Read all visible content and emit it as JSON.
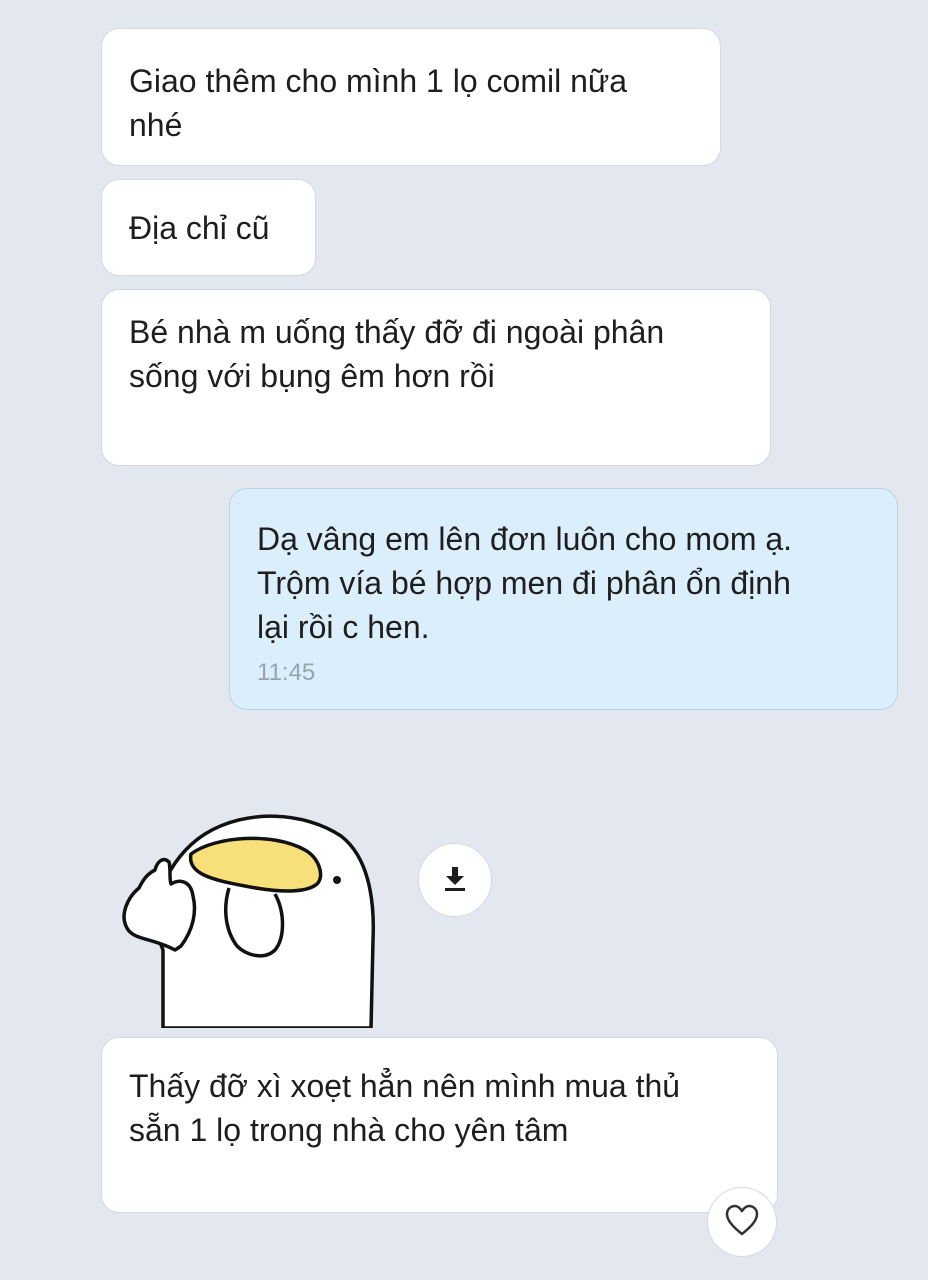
{
  "chat": {
    "messages": [
      {
        "direction": "incoming",
        "text": "Giao thêm cho mình 1 lọ comil nữa\nnhé"
      },
      {
        "direction": "incoming",
        "text": "Địa chỉ cũ"
      },
      {
        "direction": "incoming",
        "text": "Bé nhà m uống thấy đỡ đi ngoài phân\nsống với bụng êm hơn rồi"
      },
      {
        "direction": "outgoing",
        "text": "Dạ vâng em lên đơn luôn cho mom ạ.\nTrộm vía bé hợp men đi phân ổn định\nlại rồi c hen.",
        "time": "11:45"
      },
      {
        "direction": "incoming",
        "text": "Thấy đỡ xì xoẹt hẳn nên mình mua thủ\nsẵn 1 lọ trong nhà cho yên tâm"
      }
    ]
  },
  "icons": {
    "download": "download-icon",
    "like": "heart-icon"
  },
  "colors": {
    "background": "#e3e7ef",
    "incoming_bubble": "#ffffff",
    "outgoing_bubble": "#dbeefb",
    "timestamp": "#98a4ad",
    "sticker_banana": "#f7df7a"
  }
}
